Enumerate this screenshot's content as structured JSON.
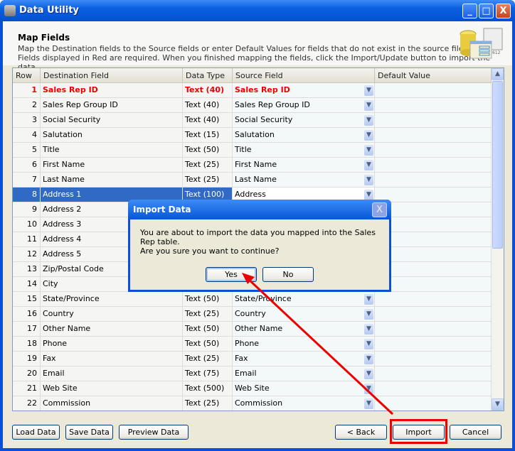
{
  "window": {
    "title": "Data Utility",
    "minimize": "_",
    "maximize": "□",
    "close": "X"
  },
  "header": {
    "title": "Map Fields",
    "line1": "Map the Destination fields to the Source fields or enter Default Values for fields that do not exist in the source file.",
    "line2": "Fields displayed in Red are required.  When you finished mapping the fields, click the Import/Update button to import the data.",
    "icon_label": "612"
  },
  "grid": {
    "columns": [
      "Row",
      "Destination Field",
      "Data Type",
      "Source Field",
      "Default Value"
    ],
    "rows": [
      {
        "row": "1",
        "dest": "Sales Rep ID",
        "type": "Text (40)",
        "source": "Sales Rep ID",
        "default": "",
        "required": true
      },
      {
        "row": "2",
        "dest": "Sales Rep Group ID",
        "type": "Text (40)",
        "source": "Sales Rep Group ID",
        "default": ""
      },
      {
        "row": "3",
        "dest": "Social Security",
        "type": "Text (40)",
        "source": "Social Security",
        "default": ""
      },
      {
        "row": "4",
        "dest": "Salutation",
        "type": "Text (15)",
        "source": "Salutation",
        "default": ""
      },
      {
        "row": "5",
        "dest": "Title",
        "type": "Text (50)",
        "source": "Title",
        "default": ""
      },
      {
        "row": "6",
        "dest": "First Name",
        "type": "Text (25)",
        "source": "First Name",
        "default": ""
      },
      {
        "row": "7",
        "dest": "Last Name",
        "type": "Text (25)",
        "source": "Last Name",
        "default": ""
      },
      {
        "row": "8",
        "dest": "Address 1",
        "type": "Text (100)",
        "source": "Address",
        "default": "",
        "selected": true
      },
      {
        "row": "9",
        "dest": "Address 2",
        "type": "",
        "source": "",
        "default": ""
      },
      {
        "row": "10",
        "dest": "Address 3",
        "type": "",
        "source": "",
        "default": ""
      },
      {
        "row": "11",
        "dest": "Address 4",
        "type": "",
        "source": "",
        "default": ""
      },
      {
        "row": "12",
        "dest": "Address 5",
        "type": "",
        "source": "",
        "default": ""
      },
      {
        "row": "13",
        "dest": "Zip/Postal Code",
        "type": "",
        "source": "",
        "default": ""
      },
      {
        "row": "14",
        "dest": "City",
        "type": "",
        "source": "",
        "default": ""
      },
      {
        "row": "15",
        "dest": "State/Province",
        "type": "Text (50)",
        "source": "State/Province",
        "default": ""
      },
      {
        "row": "16",
        "dest": "Country",
        "type": "Text (25)",
        "source": "Country",
        "default": ""
      },
      {
        "row": "17",
        "dest": "Other Name",
        "type": "Text (50)",
        "source": "Other Name",
        "default": ""
      },
      {
        "row": "18",
        "dest": "Phone",
        "type": "Text (50)",
        "source": "Phone",
        "default": ""
      },
      {
        "row": "19",
        "dest": "Fax",
        "type": "Text (25)",
        "source": "Fax",
        "default": ""
      },
      {
        "row": "20",
        "dest": "Email",
        "type": "Text (75)",
        "source": "Email",
        "default": ""
      },
      {
        "row": "21",
        "dest": "Web Site",
        "type": "Text (500)",
        "source": "Web Site",
        "default": ""
      },
      {
        "row": "22",
        "dest": "Commission",
        "type": "Text (25)",
        "source": "Commission",
        "default": ""
      }
    ]
  },
  "buttons": {
    "load": "Load Data",
    "save": "Save Data",
    "preview": "Preview Data",
    "back": "< Back",
    "import": "Import",
    "cancel": "Cancel"
  },
  "dialog": {
    "title": "Import Data",
    "message": "You are about to import the data you mapped into the  Sales Rep table.",
    "question": "Are you sure you want to continue?",
    "yes": "Yes",
    "no": "No",
    "close": "X"
  },
  "annotation": {
    "color": "#ee0000"
  },
  "colors": {
    "required": "#e00000",
    "selection": "#316ac5",
    "titlebar": "#0a5fe0"
  }
}
